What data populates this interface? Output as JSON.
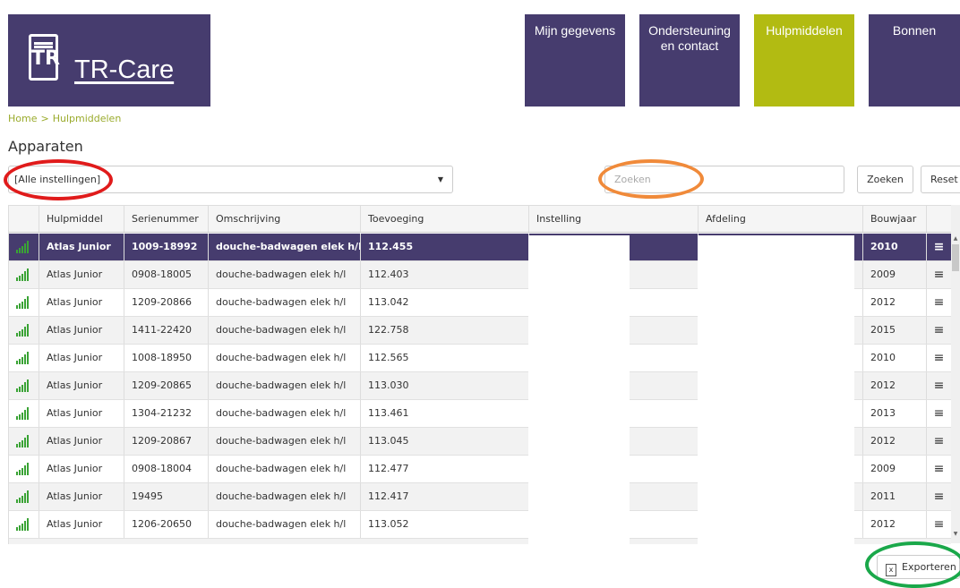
{
  "brand": {
    "name": "TR-Care",
    "mark_glyph": "TR"
  },
  "nav": [
    {
      "label": "Mijn gegevens",
      "active": false
    },
    {
      "label": "Ondersteuning en contact",
      "active": false
    },
    {
      "label": "Hulpmiddelen",
      "active": true
    },
    {
      "label": "Bonnen",
      "active": false
    }
  ],
  "breadcrumb": {
    "home": "Home",
    "separator": ">",
    "current": "Hulpmiddelen"
  },
  "page_title": "Apparaten",
  "filter": {
    "selected": "[Alle instellingen]"
  },
  "search": {
    "placeholder": "Zoeken",
    "button": "Zoeken",
    "reset": "Reset"
  },
  "table": {
    "columns": [
      "",
      "Hulpmiddel",
      "Serienummer",
      "Omschrijving",
      "Toevoeging",
      "Instelling",
      "Afdeling",
      "Bouwjaar",
      ""
    ],
    "rows": [
      {
        "device": "Atlas Junior",
        "serial": "1009-18992",
        "desc": "douche-badwagen elek h/l",
        "addition": "112.455",
        "year": "2010",
        "selected": true
      },
      {
        "device": "Atlas Junior",
        "serial": "0908-18005",
        "desc": "douche-badwagen elek h/l",
        "addition": "112.403",
        "year": "2009"
      },
      {
        "device": "Atlas Junior",
        "serial": "1209-20866",
        "desc": "douche-badwagen elek h/l",
        "addition": "113.042",
        "year": "2012"
      },
      {
        "device": "Atlas Junior",
        "serial": "1411-22420",
        "desc": "douche-badwagen elek h/l",
        "addition": "122.758",
        "year": "2015"
      },
      {
        "device": "Atlas Junior",
        "serial": "1008-18950",
        "desc": "douche-badwagen elek h/l",
        "addition": "112.565",
        "year": "2010"
      },
      {
        "device": "Atlas Junior",
        "serial": "1209-20865",
        "desc": "douche-badwagen elek h/l",
        "addition": "113.030",
        "year": "2012"
      },
      {
        "device": "Atlas Junior",
        "serial": "1304-21232",
        "desc": "douche-badwagen elek h/l",
        "addition": "113.461",
        "year": "2013"
      },
      {
        "device": "Atlas Junior",
        "serial": "1209-20867",
        "desc": "douche-badwagen elek h/l",
        "addition": "113.045",
        "year": "2012"
      },
      {
        "device": "Atlas Junior",
        "serial": "0908-18004",
        "desc": "douche-badwagen elek h/l",
        "addition": "112.477",
        "year": "2009"
      },
      {
        "device": "Atlas Junior",
        "serial": "19495",
        "desc": "douche-badwagen elek h/l",
        "addition": "112.417",
        "year": "2011"
      },
      {
        "device": "Atlas Junior",
        "serial": "1206-20650",
        "desc": "douche-badwagen elek h/l",
        "addition": "113.052",
        "year": "2012"
      }
    ]
  },
  "export": {
    "label": "Exporteren"
  },
  "colors": {
    "brand_purple": "#463c6e",
    "accent_green": "#b2bb12",
    "signal_green": "#3aa335",
    "ring_red": "#e01b1b",
    "ring_orange": "#f08a3a",
    "ring_green": "#1aa84a"
  }
}
